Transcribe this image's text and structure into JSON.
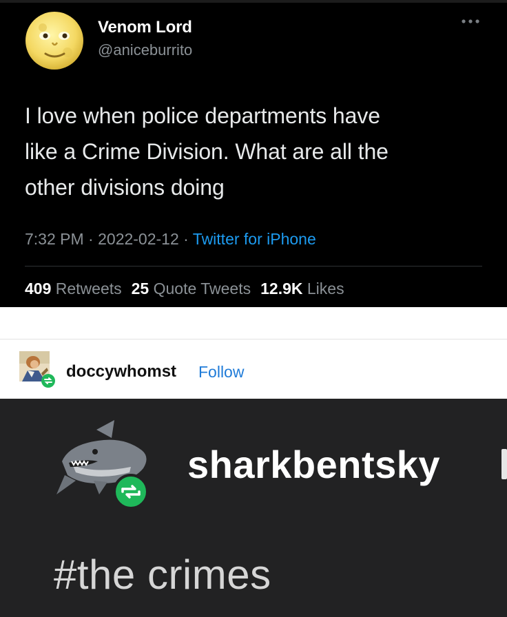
{
  "tweet": {
    "display_name": "Venom Lord",
    "handle": "@aniceburrito",
    "text_lines": [
      "I love when police departments have",
      "like a Crime Division. What are all the",
      "other divisions doing"
    ],
    "time": "7:32 PM",
    "date": "2022-02-12",
    "source": "Twitter for iPhone",
    "separator": " · ",
    "stats": {
      "retweets_count": "409",
      "retweets_label": "Retweets",
      "quotes_count": "25",
      "quotes_label": "Quote Tweets",
      "likes_count": "12.9K",
      "likes_label": "Likes"
    },
    "avatar_icon": "full-moon-face-icon",
    "more_icon": "ellipsis-icon"
  },
  "tumblr": {
    "username": "doccywhomst",
    "follow_label": "Follow",
    "avatar_icon": "painted-portrait-avatar",
    "reblog_badge_icon": "reblog-icon",
    "embedded": {
      "username": "sharkbentsky",
      "avatar_icon": "shark-icon",
      "hashtag": "#the crimes"
    }
  },
  "colors": {
    "tweet_bg": "#000000",
    "tweet_text": "#e7e9ea",
    "muted": "#8b9196",
    "twitter_blue": "#1d9bf0",
    "tumblr_follow": "#1f7bd8",
    "reblog_green": "#1fb85a",
    "dark_post_bg": "#222223"
  }
}
